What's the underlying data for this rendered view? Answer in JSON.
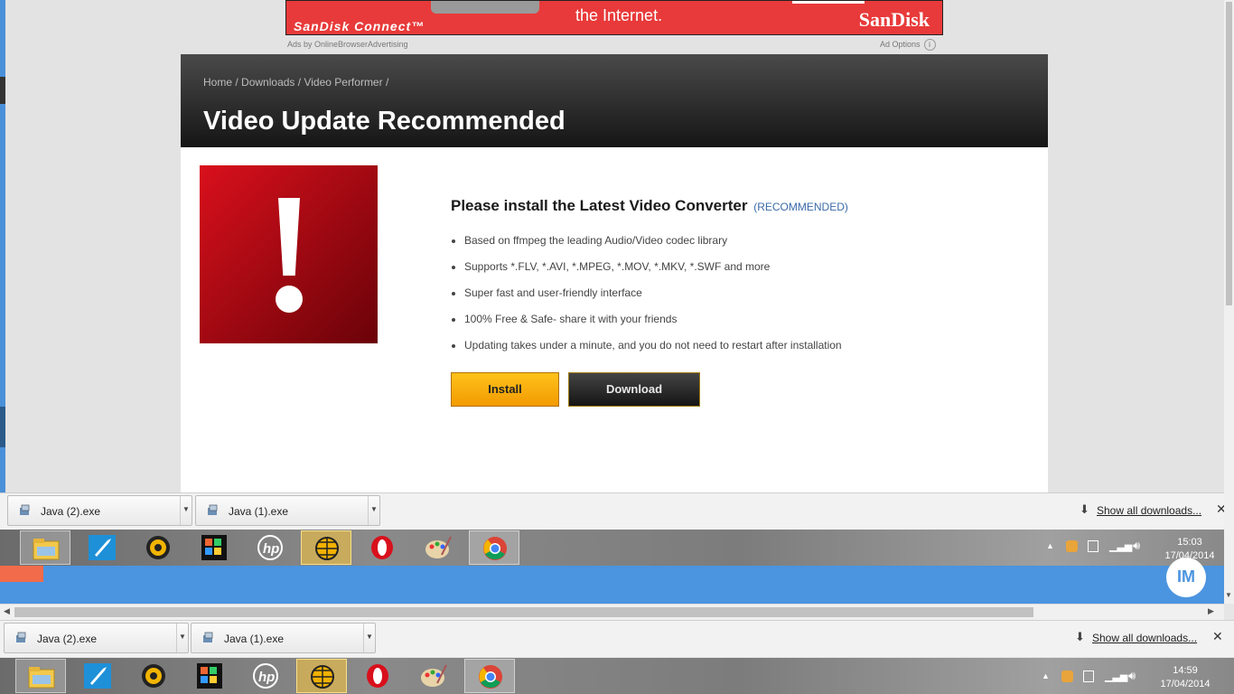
{
  "ad": {
    "product": "SanDisk Connect™",
    "tagline": "the Internet.",
    "brand": "SanDisk",
    "ads_by": "Ads by OnlineBrowserAdvertising",
    "ad_options": "Ad Options"
  },
  "breadcrumb": {
    "home": "Home",
    "downloads": "Downloads",
    "section": "Video Performer",
    "sep": "/"
  },
  "page_title": "Video Update Recommended",
  "headline": {
    "text": "Please install the Latest Video Converter",
    "tag": "(RECOMMENDED)"
  },
  "features": [
    "Based on ffmpeg the leading Audio/Video codec library",
    "Supports *.FLV, *.AVI, *.MPEG, *.MOV, *.MKV, *.SWF and more",
    "Super fast and user-friendly interface",
    "100% Free & Safe- share it with your friends",
    "Updating takes under a minute, and you do not need to restart after installation"
  ],
  "buttons": {
    "install": "Install",
    "download": "Download"
  },
  "downloads_shelf_top": {
    "items": [
      "Java (2).exe",
      "Java (1).exe"
    ],
    "show_all": "Show all downloads...",
    "close": "✕"
  },
  "downloads_shelf_bottom": {
    "items": [
      "Java (2).exe",
      "Java (1).exe"
    ],
    "show_all": "Show all downloads...",
    "close": "✕"
  },
  "taskbar_top": {
    "time": "15:03",
    "date": "17/04/2014"
  },
  "taskbar_bottom": {
    "time": "14:59",
    "date": "17/04/2014"
  },
  "im_badge": "IM",
  "taskbar_icons": [
    "file-explorer-icon",
    "rocket-app-icon",
    "media-player-icon",
    "puzzle-app-icon",
    "hp-icon",
    "globe-app-icon",
    "opera-icon",
    "paint-icon",
    "chrome-icon"
  ],
  "colors": {
    "accent_red": "#d9101c",
    "install_orange": "#f29a00",
    "link_blue": "#3a6aa8"
  }
}
